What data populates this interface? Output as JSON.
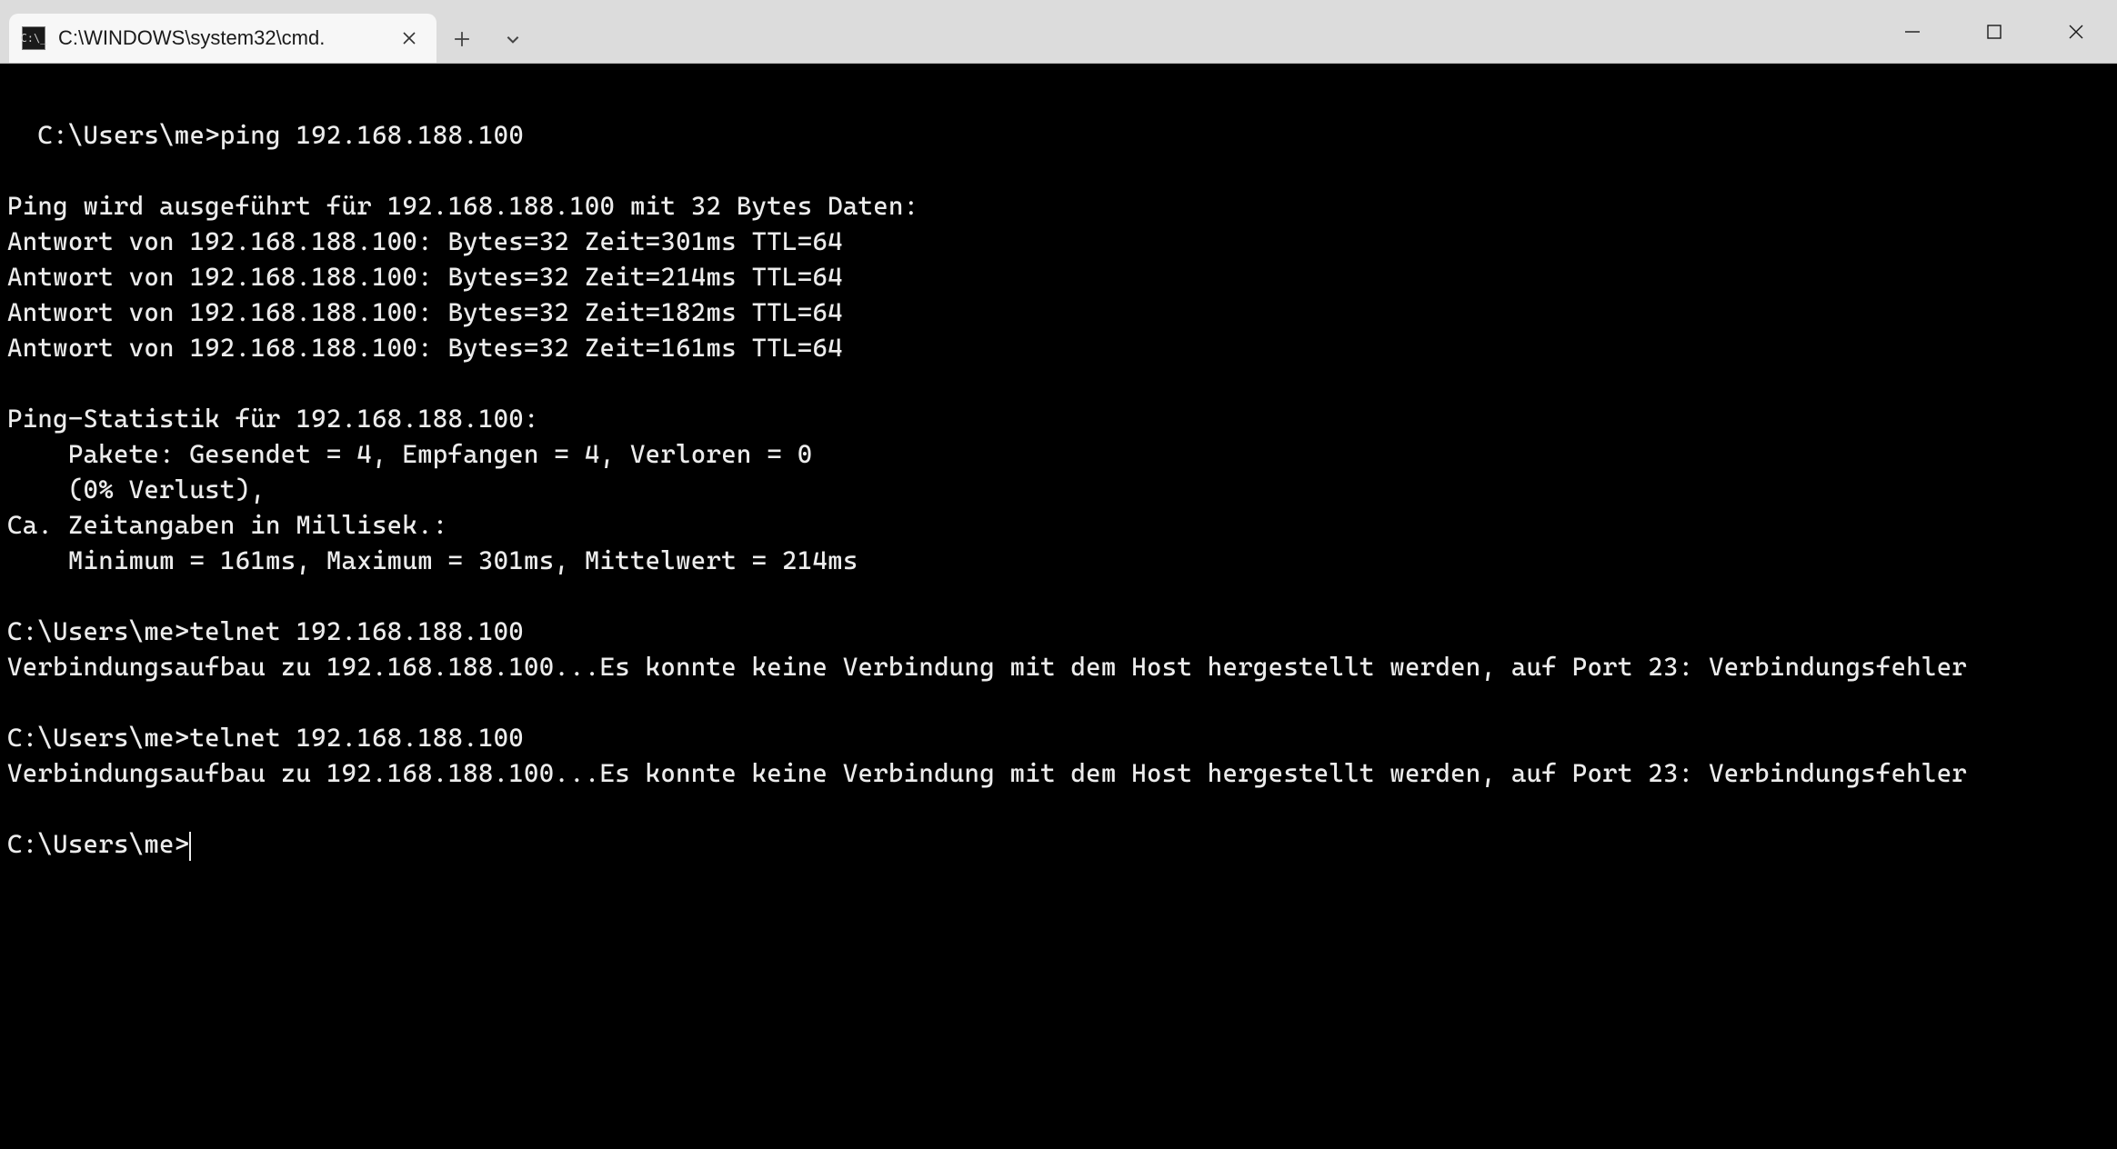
{
  "titlebar": {
    "tab_title": "C:\\WINDOWS\\system32\\cmd.",
    "tab_icon_label": "C:\\_"
  },
  "terminal": {
    "lines": [
      "C:\\Users\\me>ping 192.168.188.100",
      "",
      "Ping wird ausgeführt für 192.168.188.100 mit 32 Bytes Daten:",
      "Antwort von 192.168.188.100: Bytes=32 Zeit=301ms TTL=64",
      "Antwort von 192.168.188.100: Bytes=32 Zeit=214ms TTL=64",
      "Antwort von 192.168.188.100: Bytes=32 Zeit=182ms TTL=64",
      "Antwort von 192.168.188.100: Bytes=32 Zeit=161ms TTL=64",
      "",
      "Ping-Statistik für 192.168.188.100:",
      "    Pakete: Gesendet = 4, Empfangen = 4, Verloren = 0",
      "    (0% Verlust),",
      "Ca. Zeitangaben in Millisek.:",
      "    Minimum = 161ms, Maximum = 301ms, Mittelwert = 214ms",
      "",
      "C:\\Users\\me>telnet 192.168.188.100",
      "Verbindungsaufbau zu 192.168.188.100...Es konnte keine Verbindung mit dem Host hergestellt werden, auf Port 23: Verbindungsfehler",
      "",
      "C:\\Users\\me>telnet 192.168.188.100",
      "Verbindungsaufbau zu 192.168.188.100...Es konnte keine Verbindung mit dem Host hergestellt werden, auf Port 23: Verbindungsfehler",
      ""
    ],
    "prompt": "C:\\Users\\me>"
  }
}
